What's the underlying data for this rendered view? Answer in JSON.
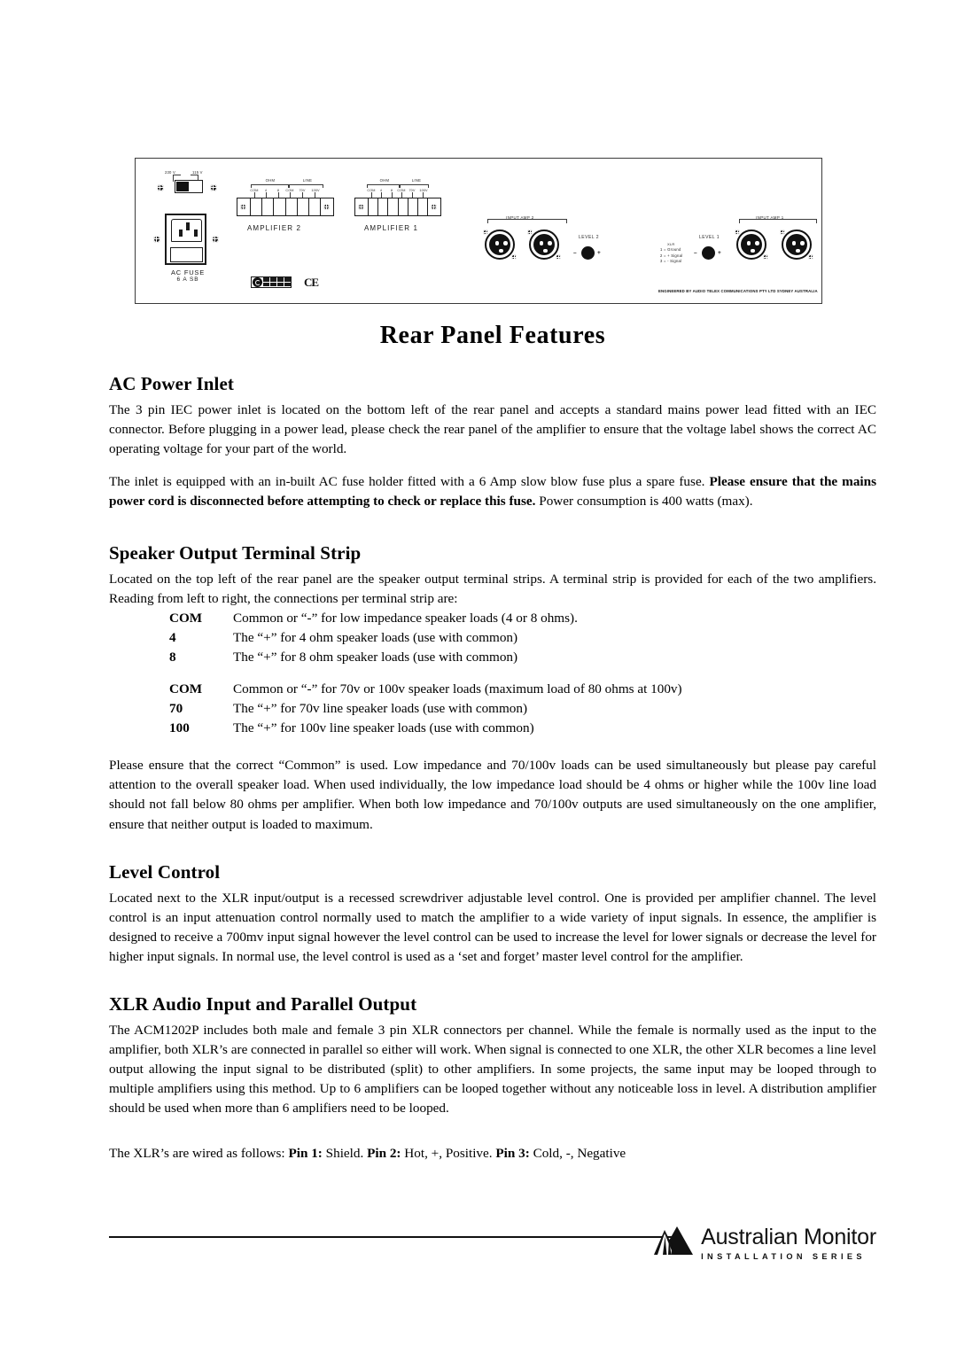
{
  "document": {
    "title": "Rear Panel Features"
  },
  "panel_diagram": {
    "voltage_selector": {
      "left_label": "230 V",
      "right_label": "115 V"
    },
    "ac_inlet": {
      "caption": "AC FUSE",
      "rating": "6 A  SB"
    },
    "terminal_strips": [
      {
        "amplifier_caption": "AMPLIFIER 2",
        "group_left": "OHM",
        "group_right": "LINE",
        "pins": [
          "COM",
          "4",
          "8",
          "COM",
          "70V",
          "100V"
        ]
      },
      {
        "amplifier_caption": "AMPLIFIER 1",
        "group_left": "OHM",
        "group_right": "LINE",
        "pins": [
          "COM",
          "4",
          "8",
          "COM",
          "70V",
          "100V"
        ]
      }
    ],
    "xlr_groups": [
      {
        "label": "INPUT AMP 2"
      },
      {
        "label": "INPUT AMP 1"
      }
    ],
    "level_controls": [
      {
        "label": "LEVEL 2",
        "minus": "–",
        "plus": "+"
      },
      {
        "label": "LEVEL 1",
        "minus": "–",
        "plus": "+"
      }
    ],
    "xlr_legend": {
      "heading": "XLR",
      "lines": [
        "1 = Ground",
        "2 =  + Signal",
        "3 =  -  Signal"
      ]
    },
    "compliance": {
      "c_tick": "C-TICK",
      "ce_mark": "CE"
    },
    "engineered_by": "ENGINEERED  BY AUDIO  TELEX COMMUNICATIONS PTY LTD SYDNEY AUSTRALIA"
  },
  "sections": {
    "ac_power_inlet": {
      "heading": "AC Power Inlet",
      "para1": "The 3 pin IEC power inlet is located on the bottom left of the rear panel and accepts a standard mains power lead fitted with an IEC connector. Before plugging in a power lead, please check the rear panel of the amplifier to ensure that the voltage label shows the correct AC operating voltage for your part of the world.",
      "para2_a": "The inlet is equipped with an in-built AC fuse holder fitted with a 6 Amp slow blow fuse plus a spare fuse. ",
      "para2_bold": "Please ensure that the mains power cord is disconnected before attempting to check or replace this fuse.",
      "para2_b": " Power consumption is 400 watts (max)."
    },
    "speaker_output": {
      "heading": "Speaker Output Terminal Strip",
      "intro": "Located on the top left of the rear panel are the speaker output terminal strips. A terminal strip is provided for each of the two amplifiers. Reading from left to right, the connections per terminal strip are:",
      "group1": [
        {
          "label": "COM",
          "desc": "Common or “-” for low impedance speaker loads (4 or 8 ohms)."
        },
        {
          "label": "4",
          "desc": "The “+” for 4 ohm speaker loads (use with common)"
        },
        {
          "label": "8",
          "desc": "The “+” for 8 ohm speaker loads (use with common)"
        }
      ],
      "group2": [
        {
          "label": "COM",
          "desc": "Common or “-” for 70v or 100v speaker loads (maximum load of 80 ohms at 100v)"
        },
        {
          "label": "70",
          "desc": "The “+” for 70v line speaker loads (use with common)"
        },
        {
          "label": "100",
          "desc": "The “+” for 100v line speaker loads (use with common)"
        }
      ],
      "outro": "Please ensure that the correct “Common” is used. Low impedance and 70/100v loads can be used simultaneously but please pay careful attention to the overall speaker load. When used individually, the low impedance load should be 4 ohms or higher while the 100v line load should not fall below 80 ohms per amplifier. When both low impedance and 70/100v outputs are used simultaneously on the one amplifier, ensure that neither output is loaded to maximum."
    },
    "level_control": {
      "heading": "Level Control",
      "para1": "Located next to the XLR input/output is a recessed screwdriver adjustable level control. One is provided per amplifier channel. The level control is an input attenuation control normally used to match the amplifier to a wide variety of input signals. In essence, the amplifier is designed to receive a 700mv input signal however the level control can be used to increase the level for lower signals or decrease the level for higher input signals. In normal use, the level control is used as a ‘set and forget’ master level control for the amplifier."
    },
    "xlr_audio": {
      "heading": "XLR Audio Input and Parallel Output",
      "para1": "The ACM1202P includes both male and female 3 pin XLR connectors per channel. While the female is normally used as the input to the amplifier, both XLR’s are connected in parallel so either will work. When signal is connected to one XLR, the other XLR becomes a line level output allowing the input signal to be distributed (split) to other amplifiers. In some projects, the same input may be looped through to multiple amplifiers using this method. Up to 6 amplifiers can be looped together without any noticeable loss in level. A distribution amplifier should be used when more than 6 amplifiers need to be looped.",
      "wiring_intro": "The XLR’s are wired as follows: ",
      "pin1_label": "Pin 1:",
      "pin1_text": " Shield.  ",
      "pin2_label": "Pin 2:",
      "pin2_text": " Hot, +, Positive. ",
      "pin3_label": "Pin 3:",
      "pin3_text": " Cold, -, Negative"
    }
  },
  "footer": {
    "brand": "Australian Monitor",
    "tagline": "INSTALLATION SERIES"
  }
}
